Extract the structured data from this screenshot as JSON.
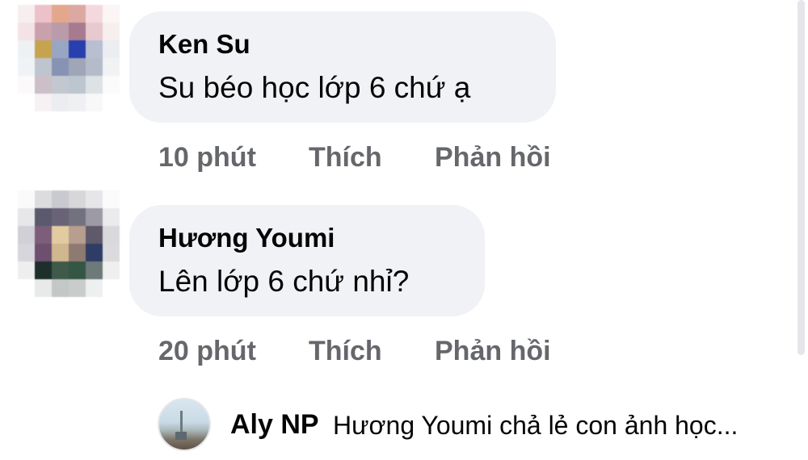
{
  "comments": [
    {
      "author": "Ken Su",
      "text": "Su béo học lớp 6 chứ ạ",
      "time": "10 phút",
      "like_label": "Thích",
      "reply_label": "Phản hồi"
    },
    {
      "author": "Hương Youmi",
      "text": "Lên lớp 6 chứ nhỉ?",
      "time": "20 phút",
      "like_label": "Thích",
      "reply_label": "Phản hồi"
    }
  ],
  "reply_preview": {
    "author": "Aly NP",
    "text": "Hương Youmi chả lẻ con ảnh học..."
  },
  "colors": {
    "bubble_bg": "#f0f2f5",
    "text": "#050505",
    "meta_text": "#65676b"
  }
}
